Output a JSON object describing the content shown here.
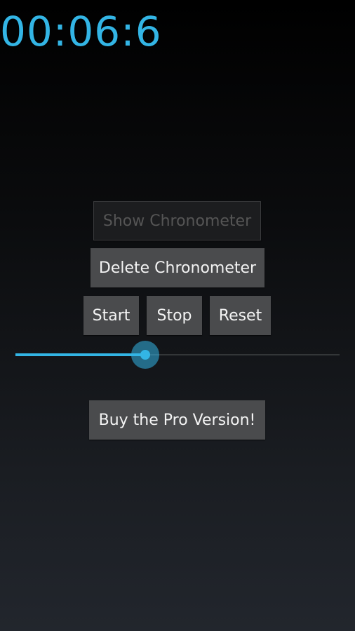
{
  "chronometer": {
    "time": "00:06:6",
    "color": "#33b5e5"
  },
  "buttons": {
    "show": "Show Chronometer",
    "delete": "Delete Chronometer",
    "start": "Start",
    "stop": "Stop",
    "reset": "Reset",
    "buy_pro": "Buy the Pro Version!"
  },
  "slider": {
    "value_fraction": 0.4
  }
}
